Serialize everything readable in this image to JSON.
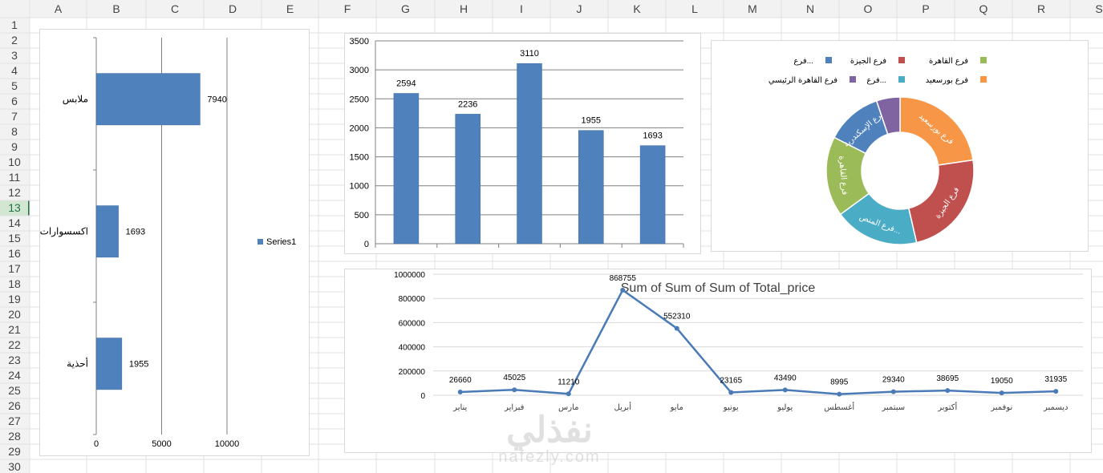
{
  "sheet": {
    "columns": [
      "A",
      "B",
      "C",
      "D",
      "E",
      "F",
      "G",
      "H",
      "I",
      "J",
      "K",
      "L",
      "M",
      "N",
      "O",
      "P",
      "Q",
      "R",
      "S"
    ],
    "rows": [
      "1",
      "2",
      "3",
      "4",
      "5",
      "6",
      "7",
      "8",
      "9",
      "10",
      "11",
      "12",
      "13",
      "14",
      "15",
      "16",
      "17",
      "18",
      "19",
      "20",
      "21",
      "22",
      "23",
      "24",
      "25",
      "26",
      "27",
      "28",
      "29",
      "30"
    ],
    "selected_row": "13",
    "colors": {
      "grid": "#e1e1e1",
      "header_bg": "#f2f2f2",
      "header_text": "#444444",
      "selected_row_bg": "#d2e6d2",
      "selected_row_text": "#217346"
    }
  },
  "watermark": {
    "arabic": "نفذلي",
    "latin": "nafezly.com"
  },
  "chart_data": [
    {
      "id": "bar-horizontal",
      "type": "bar",
      "orientation": "horizontal",
      "categories": [
        "ملابس",
        "اكسسوارات",
        "أحذية"
      ],
      "series": [
        {
          "name": "Series1",
          "values": [
            7940,
            1693,
            1955
          ]
        }
      ],
      "xlim": [
        0,
        10000
      ],
      "xticks": [
        "0",
        "5000",
        "10000"
      ],
      "grid": true,
      "legend": "right",
      "color": "#4f81bd"
    },
    {
      "id": "bar-vertical",
      "type": "bar",
      "orientation": "vertical",
      "values": [
        2594,
        2236,
        3110,
        1955,
        1693
      ],
      "ylim": [
        0,
        3500
      ],
      "yticks": [
        "0",
        "500",
        "1000",
        "1500",
        "2000",
        "2500",
        "3000",
        "3500"
      ],
      "grid": true,
      "color": "#4f81bd"
    },
    {
      "id": "donut",
      "type": "pie",
      "style": "donut",
      "legend": "top",
      "legend_entries": [
        {
          "label": "فرع...",
          "color": "#4f81bd"
        },
        {
          "label": "فرع الجيزة",
          "color": "#c0504d"
        },
        {
          "label": "فرع القاهرة",
          "color": "#9bbb59"
        },
        {
          "label": "فرع القاهرة الرئيسي",
          "color": "#8064a2"
        },
        {
          "label": "فرع...",
          "color": "#4bacc6"
        },
        {
          "label": "فرع بورسعيد",
          "color": "#f79646"
        }
      ],
      "slices": [
        {
          "label": "فرع بورسعيد",
          "value": 22,
          "color": "#f79646"
        },
        {
          "label": "فرع الجيزة",
          "value": 23,
          "color": "#c0504d"
        },
        {
          "label": "فرع المنص...",
          "value": 18,
          "color": "#4bacc6"
        },
        {
          "label": "فرع القاهرة",
          "value": 17,
          "color": "#9bbb59"
        },
        {
          "label": "فرع الإسكندرية",
          "value": 12,
          "color": "#4f81bd"
        },
        {
          "label": "",
          "value": 5,
          "color": "#8064a2"
        }
      ]
    },
    {
      "id": "line",
      "type": "line",
      "title": "Sum of Sum of Sum of Total_price",
      "categories": [
        "يناير",
        "فبراير",
        "مارس",
        "أبريل",
        "مايو",
        "يونيو",
        "يوليو",
        "أغسطس",
        "سبتمبر",
        "أكتوبر",
        "نوفمبر",
        "ديسمبر"
      ],
      "values": [
        26660,
        45025,
        11210,
        868755,
        552310,
        23165,
        43490,
        8995,
        29340,
        38695,
        19050,
        31935
      ],
      "ylim": [
        0,
        1000000
      ],
      "yticks": [
        "0",
        "200000",
        "400000",
        "600000",
        "800000",
        "1000000"
      ],
      "grid": true,
      "color": "#4a7bb7"
    }
  ]
}
